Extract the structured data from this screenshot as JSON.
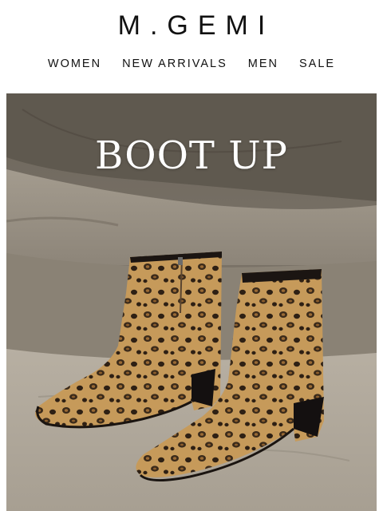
{
  "brand": {
    "logo_text": "M.GEMI"
  },
  "nav": {
    "items": [
      {
        "label": "WOMEN"
      },
      {
        "label": "NEW ARRIVALS"
      },
      {
        "label": "MEN"
      },
      {
        "label": "SALE"
      }
    ]
  },
  "hero": {
    "title": "BOOT UP",
    "image_subject": "leopard-print ankle boots on stone steps"
  },
  "colors": {
    "text": "#111111",
    "background": "#ffffff",
    "hero_title": "#ffffff"
  }
}
